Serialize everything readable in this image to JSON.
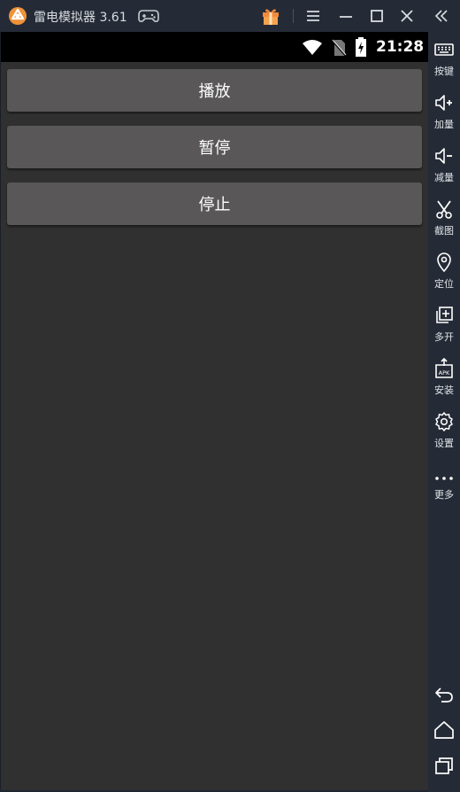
{
  "titlebar": {
    "app_title": "雷电模拟器 3.61",
    "accent": "#f0923a"
  },
  "statusbar": {
    "time": "21:28"
  },
  "buttons": {
    "play": "播放",
    "pause": "暂停",
    "stop": "停止"
  },
  "sidebar": {
    "items": [
      {
        "label": "按键",
        "icon": "keyboard-icon"
      },
      {
        "label": "加量",
        "icon": "volume-up-icon"
      },
      {
        "label": "减量",
        "icon": "volume-down-icon"
      },
      {
        "label": "截图",
        "icon": "scissors-icon"
      },
      {
        "label": "定位",
        "icon": "location-pin-icon"
      },
      {
        "label": "多开",
        "icon": "multi-instance-icon"
      },
      {
        "label": "安装",
        "icon": "apk-install-icon"
      },
      {
        "label": "设置",
        "icon": "gear-icon"
      },
      {
        "label": "更多",
        "icon": "more-dots-icon"
      }
    ]
  },
  "colors": {
    "screen_bg": "#303030",
    "button_bg": "#595757",
    "chrome_bg": "#252b36"
  }
}
